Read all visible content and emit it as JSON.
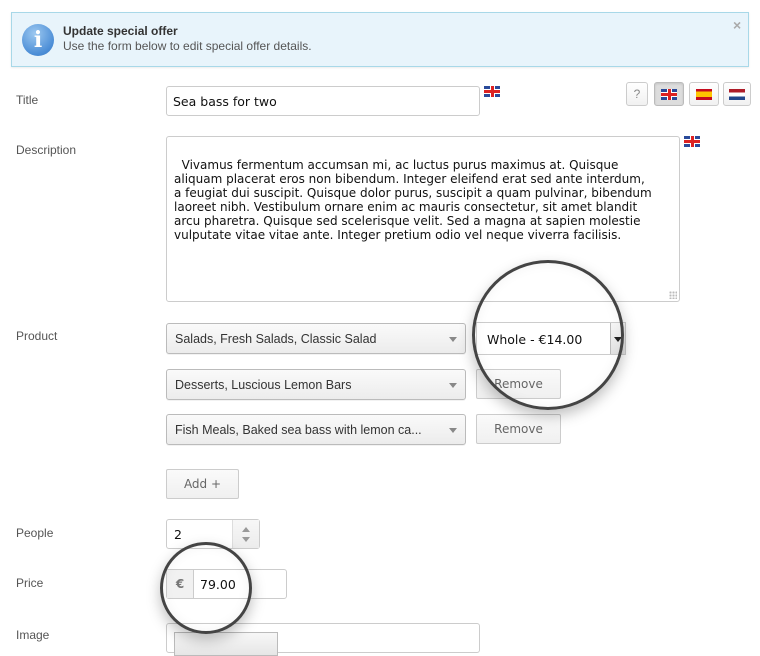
{
  "banner": {
    "icon": "info-icon",
    "title": "Update special offer",
    "text": "Use the form below to edit special offer details.",
    "close_glyph": "×"
  },
  "language_bar": {
    "help_label": "?",
    "languages": [
      {
        "code": "en",
        "icon": "flag-uk-icon",
        "active": true
      },
      {
        "code": "es",
        "icon": "flag-es-icon",
        "active": false
      },
      {
        "code": "nl",
        "icon": "flag-nl-icon",
        "active": false
      }
    ]
  },
  "form": {
    "title": {
      "label": "Title",
      "value": "Sea bass for two",
      "language_icon": "flag-uk-icon"
    },
    "description": {
      "label": "Description",
      "value": "Vivamus fermentum accumsan mi, ac luctus purus maximus at. Quisque\naliquam placerat eros non bibendum. Integer eleifend erat sed ante interdum,\na feugiat dui suscipit. Quisque dolor purus, suscipit a quam pulvinar, bibendum\nlaoreet nibh. Vestibulum ornare enim ac mauris consectetur, sit amet blandit\narcu pharetra. Quisque sed scelerisque velit. Sed a magna at sapien molestie\nvulputate vitae vitae ante. Integer pretium odio vel neque viverra facilisis.",
      "language_icon": "flag-uk-icon"
    },
    "product": {
      "label": "Product",
      "items": [
        {
          "value": "Salads, Fresh Salads, Classic Salad",
          "variant": "Whole - €14.00"
        },
        {
          "value": "Desserts, Luscious Lemon Bars",
          "action": "Remove"
        },
        {
          "value": "Fish Meals, Baked sea bass with lemon ca...",
          "action": "Remove"
        }
      ],
      "add_label": "Add +"
    },
    "people": {
      "label": "People",
      "value": "2"
    },
    "price": {
      "label": "Price",
      "currency": "€",
      "value": "79.00"
    },
    "image": {
      "label": "Image"
    }
  }
}
